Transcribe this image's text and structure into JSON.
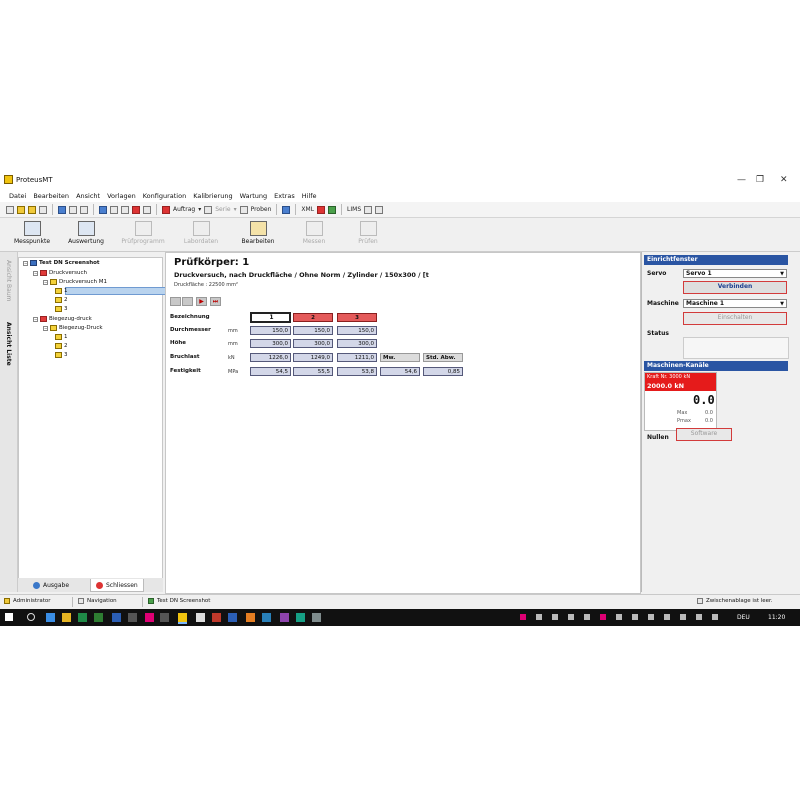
{
  "window": {
    "title": "ProteusMT",
    "btn_minimize": "—",
    "btn_maximize": "❐",
    "btn_close": "✕"
  },
  "menu": [
    "Datei",
    "Bearbeiten",
    "Ansicht",
    "Vorlagen",
    "Konfiguration",
    "Kalibrierung",
    "Wartung",
    "Extras",
    "Hilfe"
  ],
  "toolbar": {
    "auftrag": "Auftrag",
    "serie": "Serie",
    "proben": "Proben",
    "xml": "XML",
    "lims": "LIMS"
  },
  "ribbon": [
    {
      "label": "Messpunkte",
      "enabled": true
    },
    {
      "label": "Auswertung",
      "enabled": true
    },
    {
      "label": "Prüfprogramm",
      "enabled": false
    },
    {
      "label": "Labordaten",
      "enabled": false
    },
    {
      "label": "Bearbeiten",
      "enabled": true
    },
    {
      "label": "Messen",
      "enabled": false
    },
    {
      "label": "Prüfen",
      "enabled": false
    }
  ],
  "left_strip": {
    "tab1": "Ansicht Baum",
    "tab2": "Ansicht Liste"
  },
  "tree": {
    "root": "Test DN Screenshot",
    "n1": "Druckversuch",
    "n2": "Druckversuch M1",
    "n3": "1",
    "n4": "2",
    "n5": "3",
    "n6": "Biegezug-druck",
    "n7": "Biegezug-Druck",
    "n8": "1",
    "n9": "2",
    "n10": "3"
  },
  "bottom_tabs": {
    "ausgabe": "Ausgabe",
    "schliessen": "Schliessen"
  },
  "specimen": {
    "title": "Prüfkörper:  1",
    "subtitle": "Druckversuch, nach Druckfläche / Ohne Norm / Zylinder / 150x300 / [t",
    "area": "Druckfläche : 22500 mm²",
    "headers": {
      "bezeichnung": "Bezeichnung",
      "c1": "1",
      "c2": "2",
      "c3": "3",
      "mw": "Mw.",
      "sd": "Std. Abw."
    },
    "rows": {
      "durchmesser": {
        "label": "Durchmesser",
        "unit": "mm",
        "v1": "150,0",
        "v2": "150,0",
        "v3": "150,0"
      },
      "hoehe": {
        "label": "Höhe",
        "unit": "mm",
        "v1": "300,0",
        "v2": "300,0",
        "v3": "300,0"
      },
      "bruchlast": {
        "label": "Bruchlast",
        "unit": "kN",
        "v1": "1226,0",
        "v2": "1249,0",
        "v3": "1211,0"
      },
      "festigkeit": {
        "label": "Festigkeit",
        "unit": "MPa",
        "v1": "54,5",
        "v2": "55,5",
        "v3": "53,8",
        "mw": "54,6",
        "sd": "0,85"
      }
    }
  },
  "right_panel": {
    "einricht_title": "Einrichtfenster",
    "servo_label": "Servo",
    "servo_value": "Servo 1",
    "verbinden": "Verbinden",
    "maschine_label": "Maschine",
    "maschine_value": "Maschine 1",
    "einschalten": "Einschalten",
    "status_label": "Status",
    "kanal_title": "Maschinen-Kanäle",
    "kanal_name": "Kraft Nr. 3000 kN",
    "kanal_range": "2000.0 kN",
    "kanal_value": "0.0",
    "max_label": "Max",
    "max_value": "0.0",
    "pmax_label": "Pmax",
    "pmax_value": "0.0",
    "nullen_label": "Nullen",
    "software": "Software"
  },
  "statusbar": {
    "user": "Administrator",
    "nav": "Navigation",
    "doc": "Test DN Screenshot",
    "clip": "Zwischenablage ist leer."
  },
  "taskbar": {
    "lang": "DEU",
    "time": "11:20"
  },
  "colors": {
    "accent_blue": "#2a55a3",
    "header_red": "#e45a5a",
    "cell_blue": "#d3d7e8",
    "taskbar": "#111111"
  }
}
